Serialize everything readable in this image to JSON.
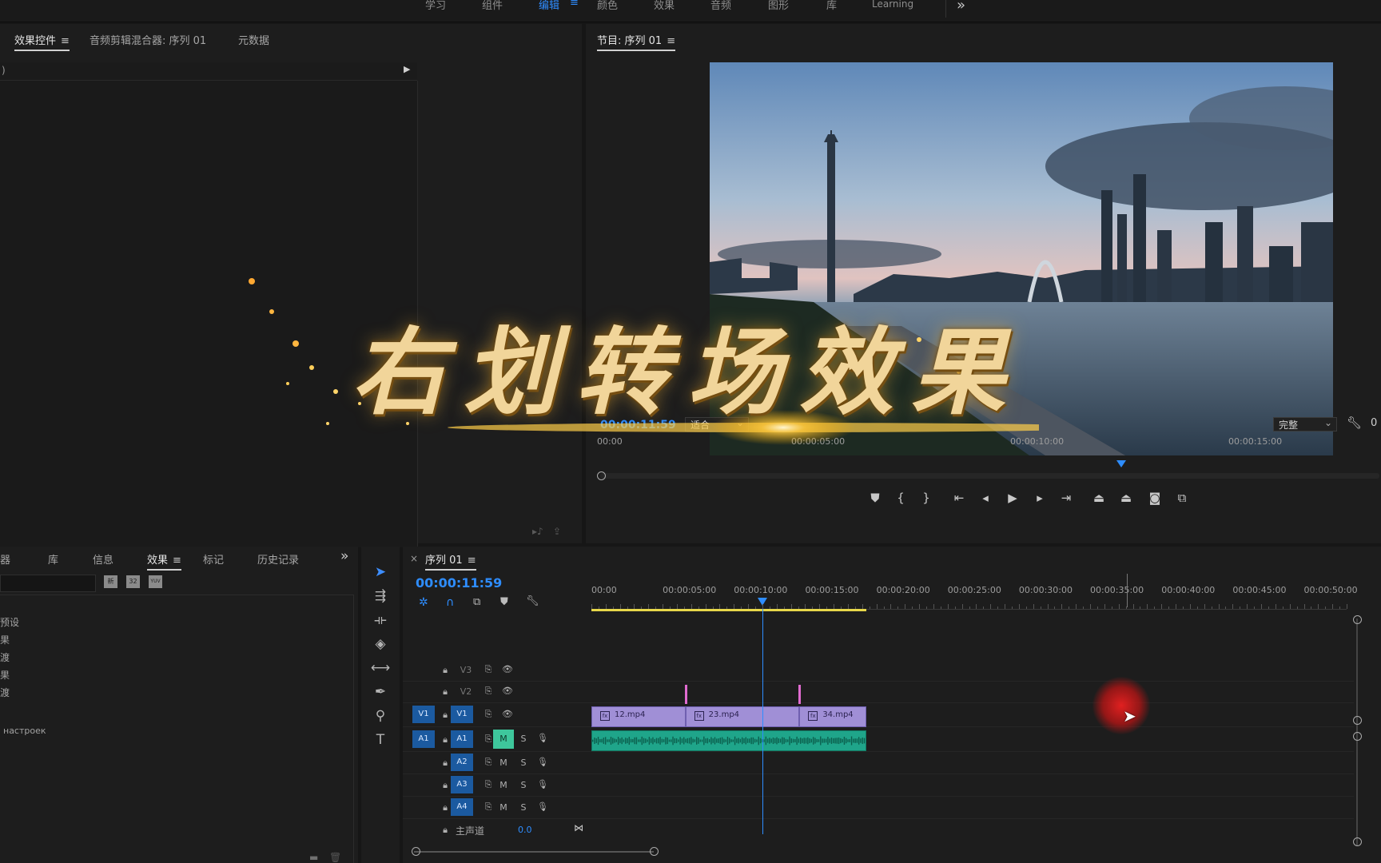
{
  "workspaces": {
    "items": [
      "学习",
      "组件",
      "编辑",
      "颜色",
      "效果",
      "音频",
      "图形",
      "库",
      "Learning"
    ],
    "active_index": 2,
    "more": "»"
  },
  "source_panel": {
    "tabs": [
      {
        "label": "效果控件",
        "active": true
      },
      {
        "label": "音频剪辑混合器: 序列 01",
        "active": false
      },
      {
        "label": "元数据",
        "active": false
      }
    ],
    "header_fragment": ")"
  },
  "program_monitor": {
    "title": "节目: 序列 01",
    "timecode": "00:00:11:59",
    "zoom": "适合",
    "quality": "完整",
    "right_timecode_fragment": "0",
    "ruler": [
      "00:00",
      "00:00:05:00",
      "00:00:10:00",
      "00:00:15:00"
    ],
    "playhead_fraction": 0.72
  },
  "overlay_title": "右划转场效果",
  "effects_panel": {
    "tabs": [
      {
        "label": "器",
        "active": false
      },
      {
        "label": "库",
        "active": false
      },
      {
        "label": "信息",
        "active": false
      },
      {
        "label": "效果",
        "active": true
      },
      {
        "label": "标记",
        "active": false
      },
      {
        "label": "历史记录",
        "active": false
      }
    ],
    "more": "»",
    "small_buttons": [
      "新",
      "32",
      "YUV"
    ],
    "items": [
      "预设",
      "果",
      "渡",
      "果",
      "渡",
      "настроек"
    ]
  },
  "timeline": {
    "title": "序列 01",
    "timecode": "00:00:11:59",
    "ruler": [
      "00:00",
      "00:00:05:00",
      "00:00:10:00",
      "00:00:15:00",
      "00:00:20:00",
      "00:00:25:00",
      "00:00:30:00",
      "00:00:35:00",
      "00:00:40:00",
      "00:00:45:00",
      "00:00:50:00"
    ],
    "video_tracks": [
      {
        "label": "V3",
        "source": ""
      },
      {
        "label": "V2",
        "source": ""
      },
      {
        "label": "V1",
        "source": "V1"
      }
    ],
    "audio_tracks": [
      {
        "label": "A1",
        "source": "A1",
        "m": "M",
        "s": "S",
        "m_active": true
      },
      {
        "label": "A2",
        "source": "",
        "m": "M",
        "s": "S",
        "m_active": false
      },
      {
        "label": "A3",
        "source": "",
        "m": "M",
        "s": "S",
        "m_active": false
      },
      {
        "label": "A4",
        "source": "",
        "m": "M",
        "s": "S",
        "m_active": false
      }
    ],
    "master": {
      "label": "主声道",
      "value": "0.0"
    },
    "clips": [
      {
        "name": "12.mp4",
        "start": 0,
        "end": 6.6
      },
      {
        "name": "23.mp4",
        "start": 6.6,
        "end": 14.6
      },
      {
        "name": "34.mp4",
        "start": 14.6,
        "end": 19.3
      }
    ],
    "playhead_seconds": 11.99,
    "seconds_visible": 53
  },
  "colors": {
    "accent": "#2e8dff",
    "clip_video": "#a08fd6",
    "clip_audio": "#1fa58a",
    "track_active": "#1b5aa0",
    "mute_active": "#3ec79c",
    "cursor_glow": "#e02020"
  }
}
